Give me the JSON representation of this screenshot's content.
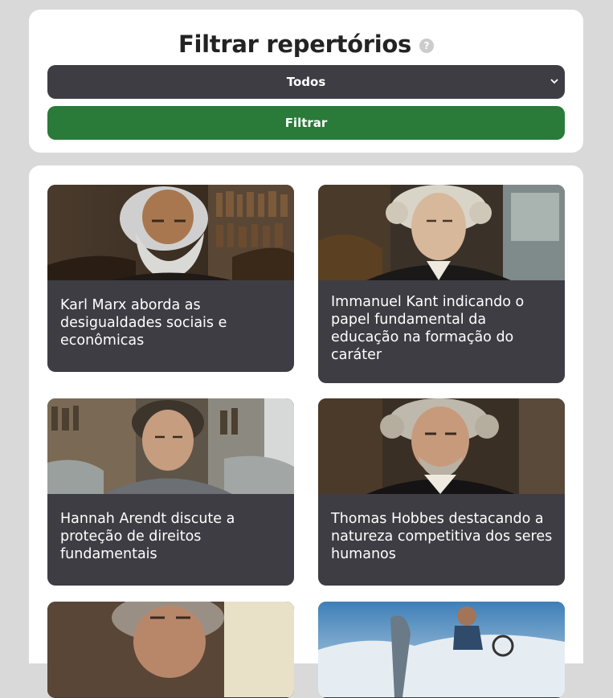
{
  "filter": {
    "title": "Filtrar repertórios",
    "help_symbol": "?",
    "select_value": "Todos",
    "button_label": "Filtrar"
  },
  "cards": [
    {
      "caption": "Karl Marx aborda as desigualdades sociais e econômicas"
    },
    {
      "caption": "Immanuel Kant indicando o papel fundamental da educação na formação do caráter"
    },
    {
      "caption": "Hannah Arendt discute a proteção de direitos fundamentais"
    },
    {
      "caption": "Thomas Hobbes destacando a natureza competitiva dos seres humanos"
    },
    {
      "caption": ""
    },
    {
      "caption": ""
    }
  ],
  "colors": {
    "background": "#d9d9d9",
    "panel": "#ffffff",
    "card": "#3e3d43",
    "button_green": "#2a7a39",
    "select_dark": "#3e3d43"
  }
}
